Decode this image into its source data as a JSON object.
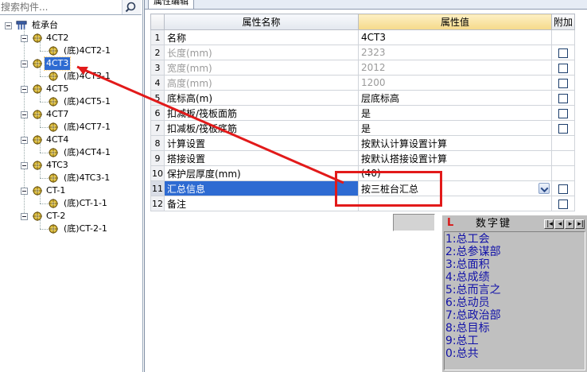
{
  "search": {
    "placeholder": "搜索构件..."
  },
  "tree": {
    "root": {
      "label": "桩承台"
    },
    "nodes": [
      {
        "label": "4CT2",
        "child": "(底)4CT2-1",
        "selected": false
      },
      {
        "label": "4CT3",
        "child": "(底)4CT3-1",
        "selected": true
      },
      {
        "label": "4CT5",
        "child": "(底)4CT5-1",
        "selected": false
      },
      {
        "label": "4CT7",
        "child": "(底)4CT7-1",
        "selected": false
      },
      {
        "label": "4CT4",
        "child": "(底)4CT4-1",
        "selected": false
      },
      {
        "label": "4TC3",
        "child": "(底)4TC3-1",
        "selected": false
      },
      {
        "label": "CT-1",
        "child": "(底)CT-1-1",
        "selected": false
      },
      {
        "label": "CT-2",
        "child": "(底)CT-2-1",
        "selected": false
      }
    ]
  },
  "tab": {
    "label": "属性编辑"
  },
  "grid": {
    "headers": {
      "num": "",
      "name": "属性名称",
      "value": "属性值",
      "add": "附加"
    },
    "rows": [
      {
        "n": "1",
        "name": "名称",
        "value": "4CT3",
        "gray": false,
        "check": false,
        "selected": false
      },
      {
        "n": "2",
        "name": "长度(mm)",
        "value": "2323",
        "gray": true,
        "check": true,
        "selected": false
      },
      {
        "n": "3",
        "name": "宽度(mm)",
        "value": "2012",
        "gray": true,
        "check": true,
        "selected": false
      },
      {
        "n": "4",
        "name": "高度(mm)",
        "value": "1200",
        "gray": true,
        "check": true,
        "selected": false
      },
      {
        "n": "5",
        "name": "底标高(m)",
        "value": "层底标高",
        "gray": false,
        "check": true,
        "selected": false
      },
      {
        "n": "6",
        "name": "扣减板/筏板面筋",
        "value": "是",
        "gray": false,
        "check": true,
        "selected": false
      },
      {
        "n": "7",
        "name": "扣减板/筏板底筋",
        "value": "是",
        "gray": false,
        "check": true,
        "selected": false
      },
      {
        "n": "8",
        "name": "计算设置",
        "value": "按默认计算设置计算",
        "gray": false,
        "check": false,
        "selected": false
      },
      {
        "n": "9",
        "name": "搭接设置",
        "value": "按默认搭接设置计算",
        "gray": false,
        "check": false,
        "selected": false
      },
      {
        "n": "10",
        "name": "保护层厚度(mm)",
        "value": "(40)",
        "gray": false,
        "check": false,
        "selected": false
      },
      {
        "n": "11",
        "name": "汇总信息",
        "value": "按三桩台汇总",
        "gray": false,
        "check": true,
        "selected": true
      },
      {
        "n": "12",
        "name": "备注",
        "value": "",
        "gray": false,
        "check": true,
        "selected": false
      }
    ]
  },
  "ime": {
    "logo": "L",
    "title": "数字键",
    "items": [
      "1:总工会",
      "2:总参谋部",
      "3:总面积",
      "4:总成绩",
      "5:总而言之",
      "6:总动员",
      "7:总政治部",
      "8:总目标",
      "9:总工",
      "0:总共"
    ]
  },
  "colors": {
    "selection": "#2e6bd2",
    "annotation": "#e21a1a",
    "ime_text": "#1212a8"
  }
}
